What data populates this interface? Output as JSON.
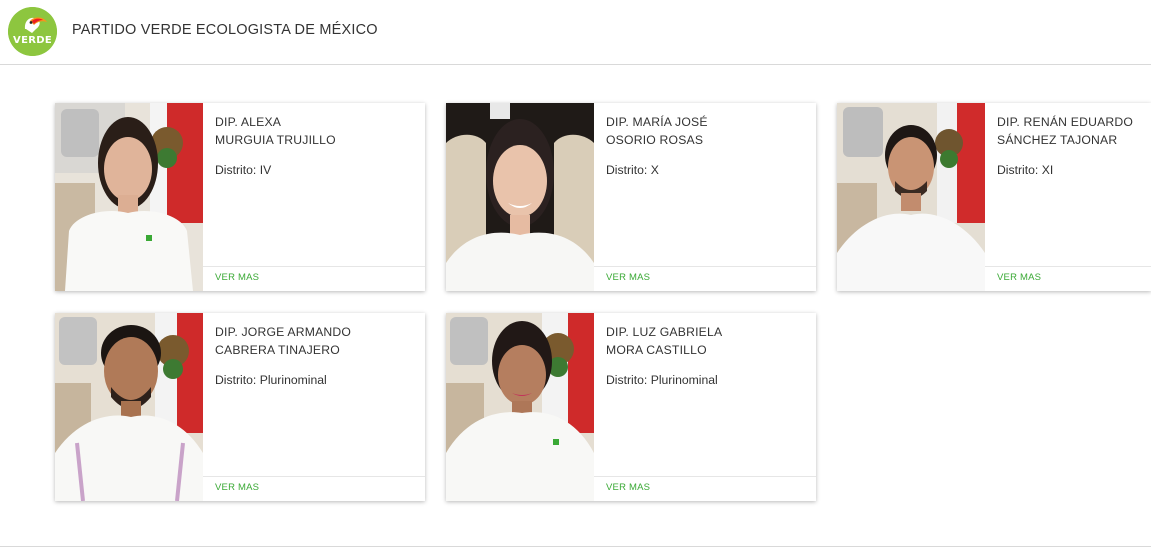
{
  "header": {
    "logo_text": "VERDE",
    "party_name": "PARTIDO VERDE ECOLOGISTA DE MÉXICO"
  },
  "cards": [
    {
      "name_line1": "DIP. ALEXA",
      "name_line2": "MURGUIA TRUJILLO",
      "district": "Distrito: IV",
      "link": "VER MAS"
    },
    {
      "name_line1": "DIP. MARÍA JOSÉ",
      "name_line2": "OSORIO ROSAS",
      "district": "Distrito: X",
      "link": "VER MAS"
    },
    {
      "name_line1": "DIP. RENÁN EDUARDO",
      "name_line2": "SÁNCHEZ TAJONAR",
      "district": "Distrito: XI",
      "link": "VER MAS"
    },
    {
      "name_line1": "DIP. JORGE ARMANDO",
      "name_line2": "CABRERA TINAJERO",
      "district": "Distrito: Plurinominal",
      "link": "VER MAS"
    },
    {
      "name_line1": "DIP. LUZ GABRIELA",
      "name_line2": "MORA CASTILLO",
      "district": "Distrito: Plurinominal",
      "link": "VER MAS"
    }
  ],
  "colors": {
    "brand_green": "#8dc63f",
    "link_green": "#3aa935"
  }
}
